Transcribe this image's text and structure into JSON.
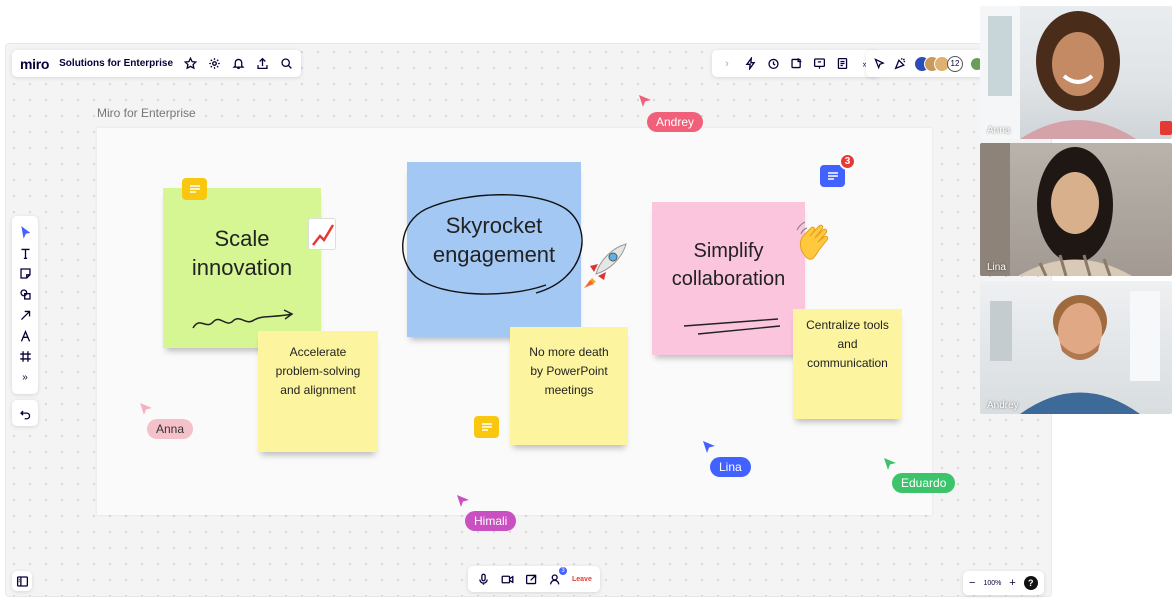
{
  "app": {
    "logo": "miro",
    "board_title": "Solutions for Enterprise"
  },
  "collaborators": {
    "count": "12"
  },
  "frame": {
    "label": "Miro for Enterprise"
  },
  "stickies": {
    "scale": "Scale innovation",
    "skyrocket": "Skyrocket engagement",
    "simplify": "Simplify collaboration",
    "accelerate": "Accelerate problem-solving and alignment",
    "powerpoint": "No more death by PowerPoint meetings",
    "centralize": "Centralize tools and communication"
  },
  "comments": {
    "badge_count": "3"
  },
  "cursors": [
    {
      "name": "Andrey",
      "color": "#f0607a"
    },
    {
      "name": "Anna",
      "color": "#f4b2be"
    },
    {
      "name": "Himali",
      "color": "#c850c0"
    },
    {
      "name": "Lina",
      "color": "#4262ff"
    },
    {
      "name": "Eduardo",
      "color": "#3dc46a"
    }
  ],
  "bottombar": {
    "leave_label": "Leave",
    "badge": "3"
  },
  "zoom": {
    "level": "100%",
    "minus": "−",
    "plus": "+",
    "help": "?"
  },
  "videos": [
    {
      "name": "Anna"
    },
    {
      "name": "Lina"
    },
    {
      "name": "Andrey"
    }
  ]
}
